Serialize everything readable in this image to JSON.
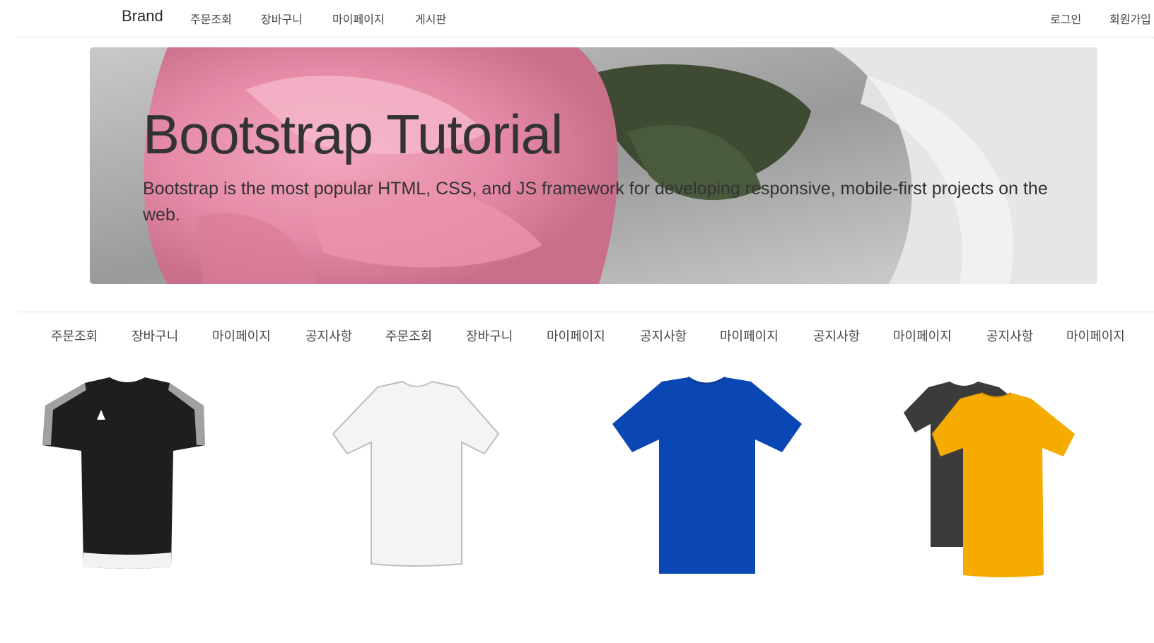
{
  "navbar": {
    "brand": "Brand",
    "links": [
      "주문조회",
      "장바구니",
      "마이페이지",
      "게시판"
    ],
    "right_links": [
      "로그인",
      "회원가입"
    ]
  },
  "jumbotron": {
    "title": "Bootstrap Tutorial",
    "text": "Bootstrap is the most popular HTML, CSS, and JS framework for developing responsive, mobile-first projects on the web."
  },
  "subnav": {
    "items": [
      "주문조회",
      "장바구니",
      "마이페이지",
      "공지사항",
      "주문조회",
      "장바구니",
      "마이페이지",
      "공지사항",
      "마이페이지",
      "공지사항",
      "마이페이지",
      "공지사항",
      "마이페이지"
    ]
  },
  "products": [
    {
      "image": "black-tshirt-image",
      "color": "#222222"
    },
    {
      "image": "white-tshirt-image",
      "color": "#f3f3f3"
    },
    {
      "image": "blue-tshirt-image",
      "color": "#0a47b5"
    },
    {
      "image": "yellow-tshirt-image",
      "color": "#f5ab00"
    }
  ]
}
